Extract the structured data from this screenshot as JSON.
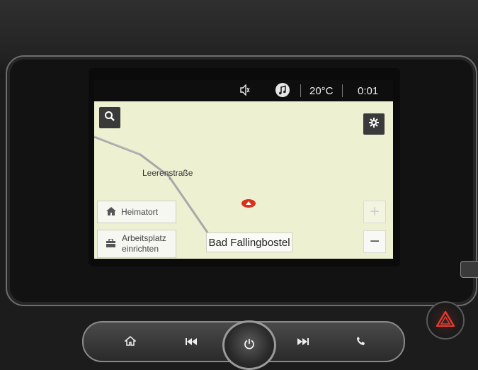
{
  "status": {
    "temperature": "20°C",
    "time": "0:01",
    "icons": [
      "speaker-muted-icon",
      "music-note-icon"
    ]
  },
  "map": {
    "street_label": "Leerenstraße",
    "city_label": "Bad Fallingbostel",
    "home_button_label": "Heimatort",
    "work_button_label_line1": "Arbeitsplatz",
    "work_button_label_line2": "einrichten",
    "search_icon": "search-icon",
    "settings_icon": "gear-icon",
    "zoom_in": "+",
    "zoom_out": "−",
    "route_color": "#a8a8a8",
    "vehicle_color": "#d8301c"
  },
  "controls": {
    "icons": [
      "home-icon",
      "previous-track-icon",
      "power-icon",
      "next-track-icon",
      "phone-icon",
      "hazard-icon"
    ]
  }
}
